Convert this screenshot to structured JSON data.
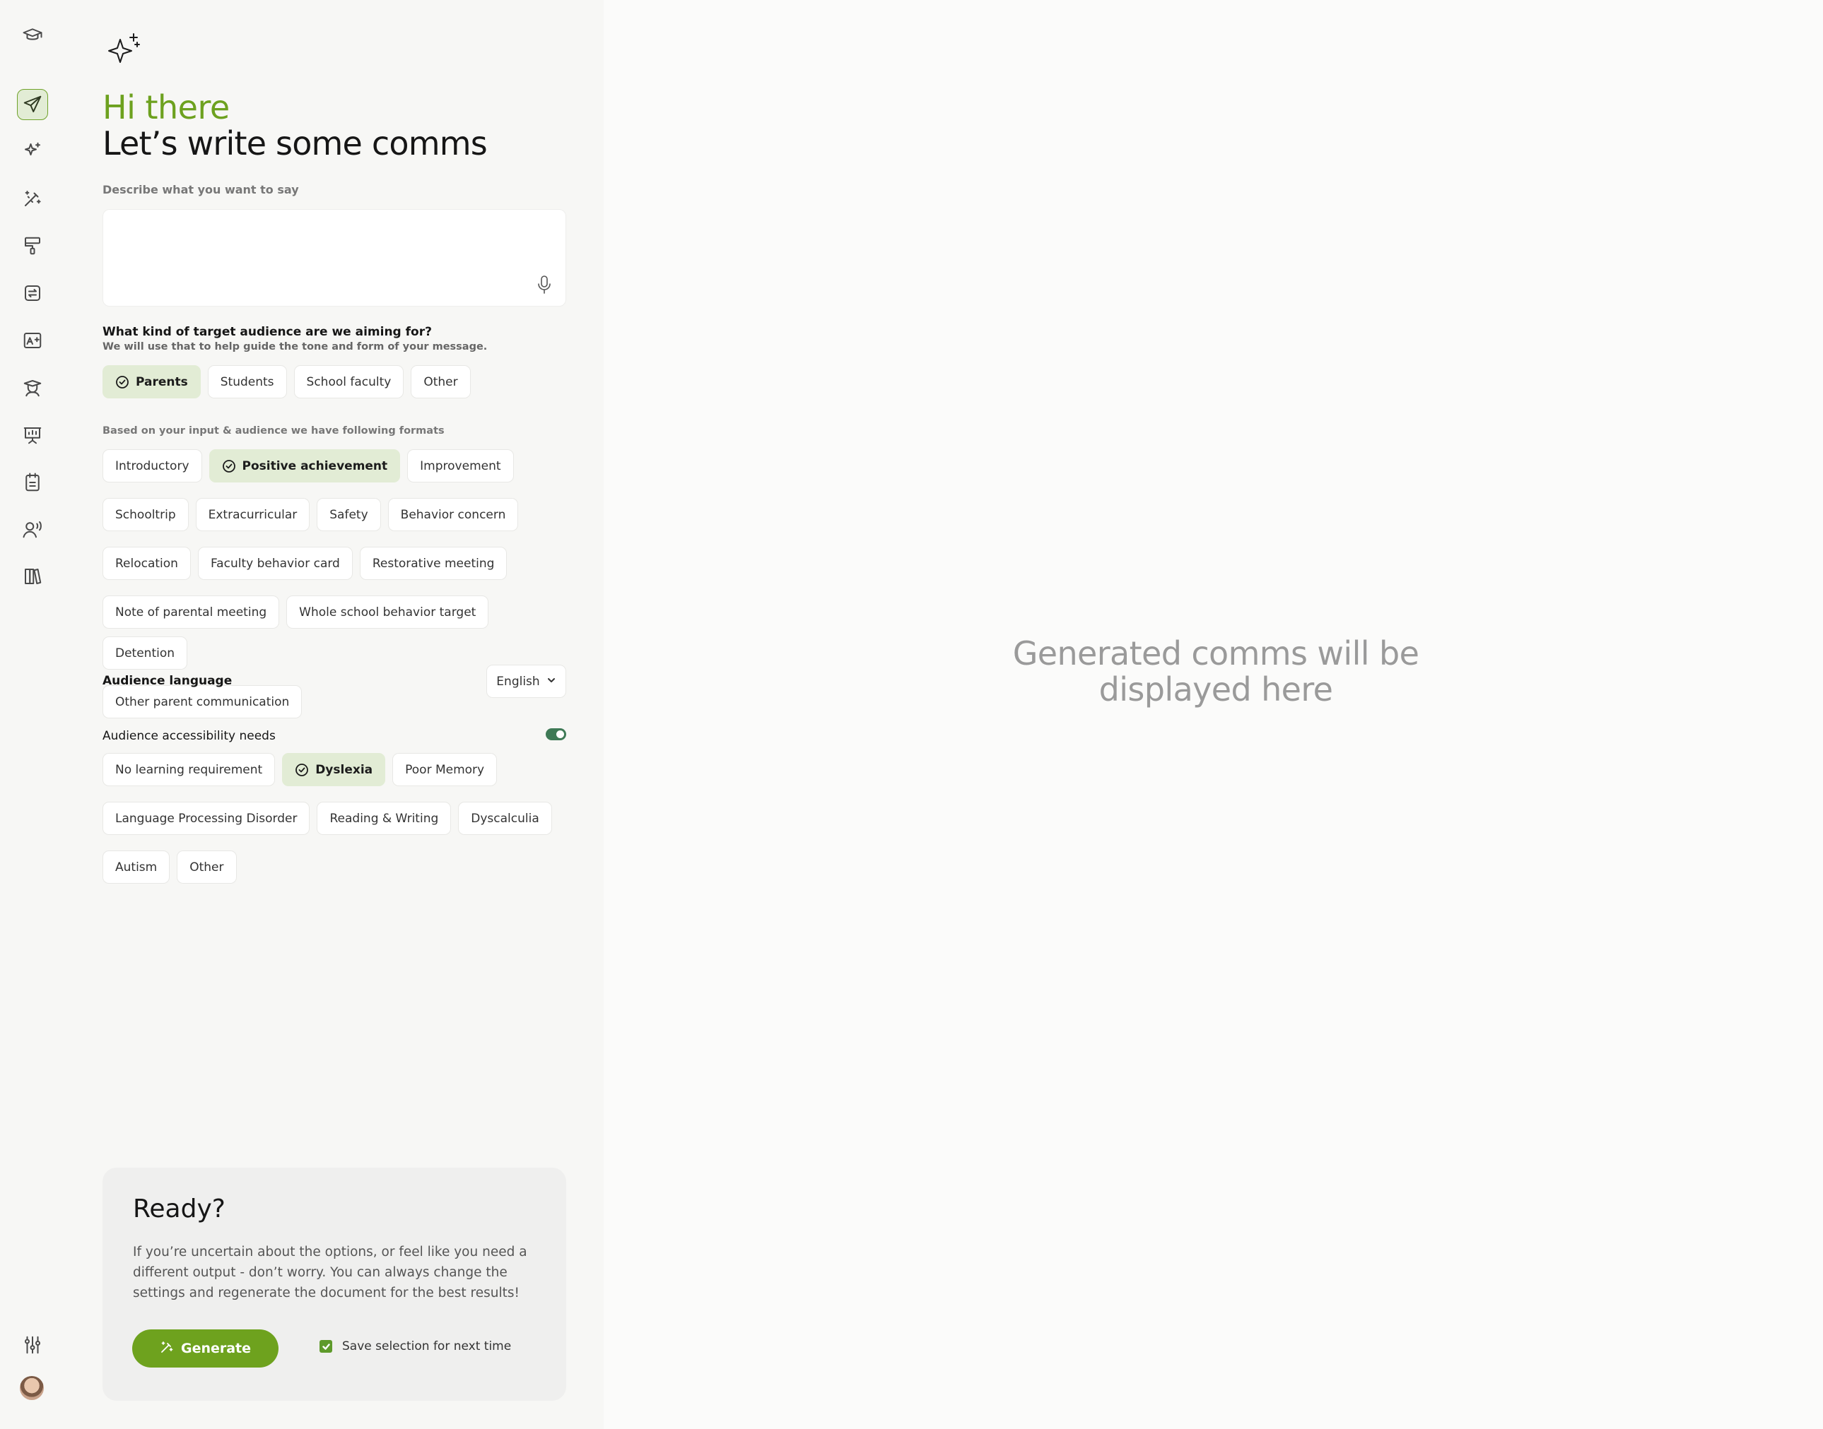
{
  "rail": {
    "items": [
      {
        "name": "graduation-cap-icon"
      },
      {
        "name": "send-icon",
        "active": true
      },
      {
        "name": "sparkles-icon"
      },
      {
        "name": "magic-wand-icon"
      },
      {
        "name": "paint-roller-icon"
      },
      {
        "name": "switch-icon"
      },
      {
        "name": "grade-image-icon"
      },
      {
        "name": "teacher-icon"
      },
      {
        "name": "presentation-board-icon"
      },
      {
        "name": "clipboard-icon"
      },
      {
        "name": "speaking-person-icon"
      },
      {
        "name": "books-icon"
      }
    ],
    "bottom": [
      {
        "name": "sliders-icon"
      },
      {
        "name": "avatar"
      }
    ]
  },
  "header": {
    "greeting": "Hi there",
    "title": "Let’s write some comms"
  },
  "prompt": {
    "label": "Describe what you want to say",
    "value": "",
    "placeholder": ""
  },
  "audience": {
    "question": "What kind of target audience are we aiming for?",
    "subtitle": "We will use that to help guide the tone and form of your message.",
    "options": [
      "Parents",
      "Students",
      "School faculty",
      "Other"
    ],
    "selected": "Parents"
  },
  "formats": {
    "label": "Based on your input & audience we have following formats",
    "options": [
      "Introductory",
      "Positive achievement",
      "Improvement",
      "Schooltrip",
      "Extracurricular",
      "Safety",
      "Behavior concern",
      "Relocation",
      "Faculty behavior card",
      "Restorative meeting",
      "Note of parental meeting",
      "Whole school behavior target",
      "Detention",
      "Other parent communication"
    ],
    "selected": "Positive achievement"
  },
  "language": {
    "label": "Audience language",
    "value": "English"
  },
  "accessibility": {
    "label": "Audience accessibility needs",
    "enabled": true,
    "options": [
      "No learning requirement",
      "Dyslexia",
      "Poor Memory",
      "Language Processing Disorder",
      "Reading & Writing",
      "Dyscalculia",
      "Autism",
      "Other"
    ],
    "selected": "Dyslexia"
  },
  "ready": {
    "title": "Ready?",
    "text": "If you’re uncertain about the options, or feel like you need a different output - don’t worry. You can always change the settings and regenerate the document for the best results!",
    "generate_label": "Generate",
    "save_label": "Save selection for next time",
    "save_checked": true
  },
  "output": {
    "placeholder": "Generated comms will be displayed here"
  },
  "colors": {
    "accent": "#6ea21e",
    "selected_chip": "#e2ecd5",
    "toggle": "#3f7a56"
  }
}
